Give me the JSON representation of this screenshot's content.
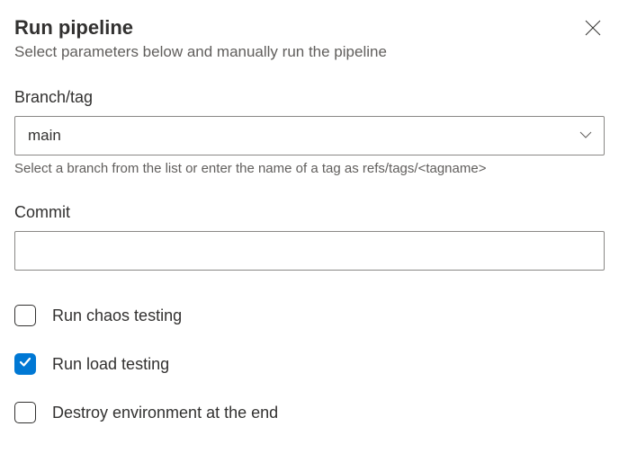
{
  "header": {
    "title": "Run pipeline",
    "subtitle": "Select parameters below and manually run the pipeline"
  },
  "branch": {
    "label": "Branch/tag",
    "value": "main",
    "helper": "Select a branch from the list or enter the name of a tag as refs/tags/<tagname>"
  },
  "commit": {
    "label": "Commit",
    "value": ""
  },
  "checkboxes": [
    {
      "label": "Run chaos testing",
      "checked": false
    },
    {
      "label": "Run load testing",
      "checked": true
    },
    {
      "label": "Destroy environment at the end",
      "checked": false
    }
  ]
}
